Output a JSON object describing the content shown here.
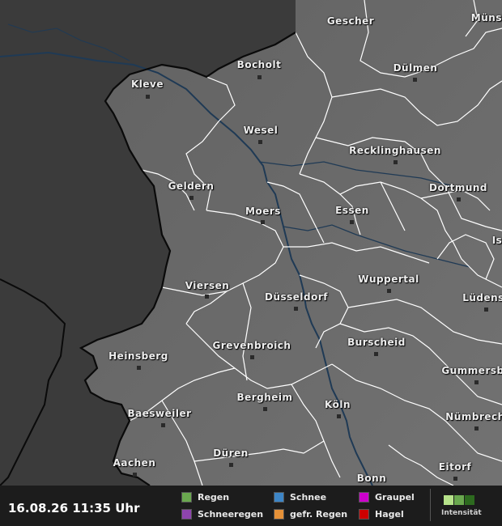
{
  "map": {
    "cities": [
      {
        "id": "gescher",
        "name": "Gescher"
      },
      {
        "id": "muenster",
        "name": "Münst"
      },
      {
        "id": "bocholt",
        "name": "Bocholt"
      },
      {
        "id": "duelmen",
        "name": "Dülmen"
      },
      {
        "id": "kleve",
        "name": "Kleve"
      },
      {
        "id": "wesel",
        "name": "Wesel"
      },
      {
        "id": "recklinghausen",
        "name": "Recklinghausen"
      },
      {
        "id": "geldern",
        "name": "Geldern"
      },
      {
        "id": "dortmund",
        "name": "Dortmund"
      },
      {
        "id": "moers",
        "name": "Moers"
      },
      {
        "id": "essen",
        "name": "Essen"
      },
      {
        "id": "iserlohn",
        "name": "Is"
      },
      {
        "id": "wuppertal",
        "name": "Wuppertal"
      },
      {
        "id": "viersen",
        "name": "Viersen"
      },
      {
        "id": "duesseldorf",
        "name": "Düsseldorf"
      },
      {
        "id": "luedenscheid",
        "name": "Lüdens"
      },
      {
        "id": "heinsberg",
        "name": "Heinsberg"
      },
      {
        "id": "grevenbroich",
        "name": "Grevenbroich"
      },
      {
        "id": "burscheid",
        "name": "Burscheid"
      },
      {
        "id": "gummersbach",
        "name": "Gummersb"
      },
      {
        "id": "bergheim",
        "name": "Bergheim"
      },
      {
        "id": "baesweiler",
        "name": "Baesweiler"
      },
      {
        "id": "koeln",
        "name": "Köln"
      },
      {
        "id": "nuembrecht",
        "name": "Nümbrech"
      },
      {
        "id": "dueren",
        "name": "Düren"
      },
      {
        "id": "aachen",
        "name": "Aachen"
      },
      {
        "id": "eitorf",
        "name": "Eitorf"
      },
      {
        "id": "bonn",
        "name": "Bonn"
      }
    ]
  },
  "legend": {
    "timestamp": "16.08.26 11:35 Uhr",
    "items": [
      {
        "id": "regen",
        "label": "Regen",
        "color": "#6aa84f"
      },
      {
        "id": "schneeregen",
        "label": "Schneeregen",
        "color": "#8e44ad"
      },
      {
        "id": "schnee",
        "label": "Schnee",
        "color": "#3d85c6"
      },
      {
        "id": "gefr-regen",
        "label": "gefr. Regen",
        "color": "#e69138"
      },
      {
        "id": "graupel",
        "label": "Graupel",
        "color": "#cc00cc"
      },
      {
        "id": "hagel",
        "label": "Hagel",
        "color": "#cc0000"
      }
    ],
    "intensity_label": "Intensität",
    "intensity_colors": [
      "#b6e28a",
      "#6aa84f",
      "#2d6a1f"
    ]
  }
}
